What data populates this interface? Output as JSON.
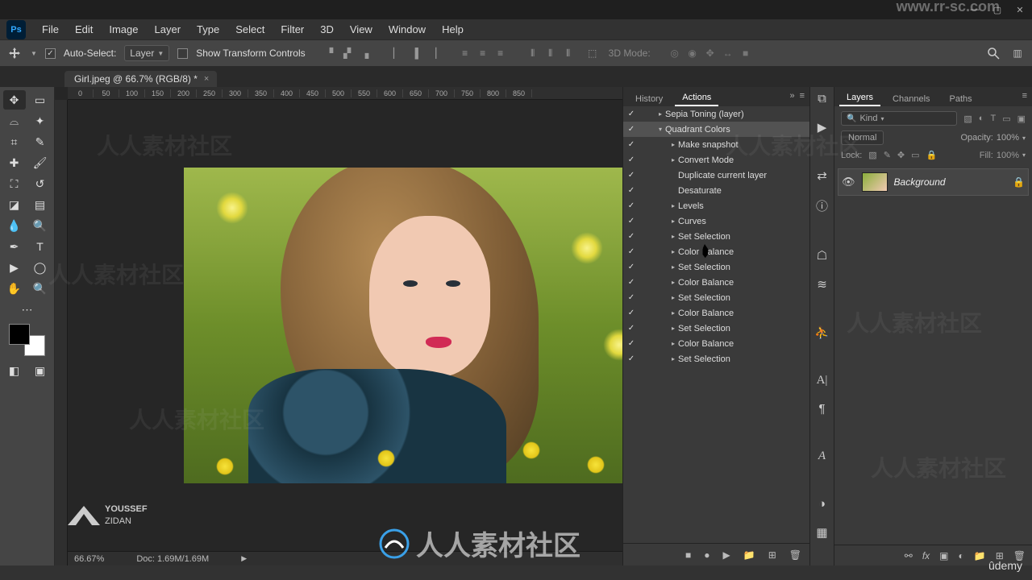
{
  "titlebar": {
    "watermark_url": "www.rr-sc.com"
  },
  "menubar": {
    "items": [
      "File",
      "Edit",
      "Image",
      "Layer",
      "Type",
      "Select",
      "Filter",
      "3D",
      "View",
      "Window",
      "Help"
    ]
  },
  "optionsbar": {
    "auto_select_checked": true,
    "auto_select_label": "Auto-Select:",
    "auto_select_target": "Layer",
    "show_transform_checked": false,
    "show_transform_label": "Show Transform Controls",
    "mode_3d_label": "3D Mode:"
  },
  "doc_tab": {
    "title": "Girl.jpeg @ 66.7% (RGB/8) *"
  },
  "ruler_marks": [
    "0",
    "50",
    "100",
    "150",
    "200",
    "250",
    "300",
    "350",
    "400",
    "450",
    "500",
    "550",
    "600",
    "650",
    "700",
    "750",
    "800",
    "850"
  ],
  "status": {
    "zoom": "66.67%",
    "doc_size": "Doc: 1.69M/1.69M"
  },
  "actions_panel": {
    "tabs": [
      "History",
      "Actions"
    ],
    "active_tab": 1,
    "items": [
      {
        "checked": true,
        "depth": 0,
        "caret": "right",
        "label": "Sepia Toning (layer)"
      },
      {
        "checked": true,
        "depth": 0,
        "caret": "down",
        "label": "Quadrant Colors",
        "selected": true
      },
      {
        "checked": true,
        "depth": 1,
        "caret": "right",
        "label": "Make snapshot"
      },
      {
        "checked": true,
        "depth": 1,
        "caret": "right",
        "label": "Convert Mode"
      },
      {
        "checked": true,
        "depth": 1,
        "caret": "",
        "label": "Duplicate current layer"
      },
      {
        "checked": true,
        "depth": 1,
        "caret": "",
        "label": "Desaturate"
      },
      {
        "checked": true,
        "depth": 1,
        "caret": "right",
        "label": "Levels"
      },
      {
        "checked": true,
        "depth": 1,
        "caret": "right",
        "label": "Curves"
      },
      {
        "checked": true,
        "depth": 1,
        "caret": "right",
        "label": "Set Selection"
      },
      {
        "checked": true,
        "depth": 1,
        "caret": "right",
        "label": "Color Balance"
      },
      {
        "checked": true,
        "depth": 1,
        "caret": "right",
        "label": "Set Selection"
      },
      {
        "checked": true,
        "depth": 1,
        "caret": "right",
        "label": "Color Balance"
      },
      {
        "checked": true,
        "depth": 1,
        "caret": "right",
        "label": "Set Selection"
      },
      {
        "checked": true,
        "depth": 1,
        "caret": "right",
        "label": "Color Balance"
      },
      {
        "checked": true,
        "depth": 1,
        "caret": "right",
        "label": "Set Selection"
      },
      {
        "checked": true,
        "depth": 1,
        "caret": "right",
        "label": "Color Balance"
      },
      {
        "checked": true,
        "depth": 1,
        "caret": "right",
        "label": "Set Selection"
      }
    ]
  },
  "layers_panel": {
    "tabs": [
      "Layers",
      "Channels",
      "Paths"
    ],
    "active_tab": 0,
    "kind_dd": "Kind",
    "blend_mode": "Normal",
    "opacity_label": "Opacity:",
    "opacity_value": "100%",
    "lock_label": "Lock:",
    "fill_label": "Fill:",
    "fill_value": "100%",
    "layers": [
      {
        "name": "Background",
        "visible": true,
        "locked": true
      }
    ]
  },
  "credits": {
    "author_line1": "YOUSSEF",
    "author_line2": "ZIDAN"
  },
  "vstrip_icons": [
    "history-icon",
    "play-icon",
    "props-icon",
    "info-icon",
    "mannequin-icon",
    "adjust-icon",
    "persona-icon",
    "char-icon",
    "para-icon",
    "glyph-icon",
    "swatches-icon",
    "grid-icon"
  ],
  "watermark_text": "人人素材社区",
  "udemy_label": "ûdemy"
}
